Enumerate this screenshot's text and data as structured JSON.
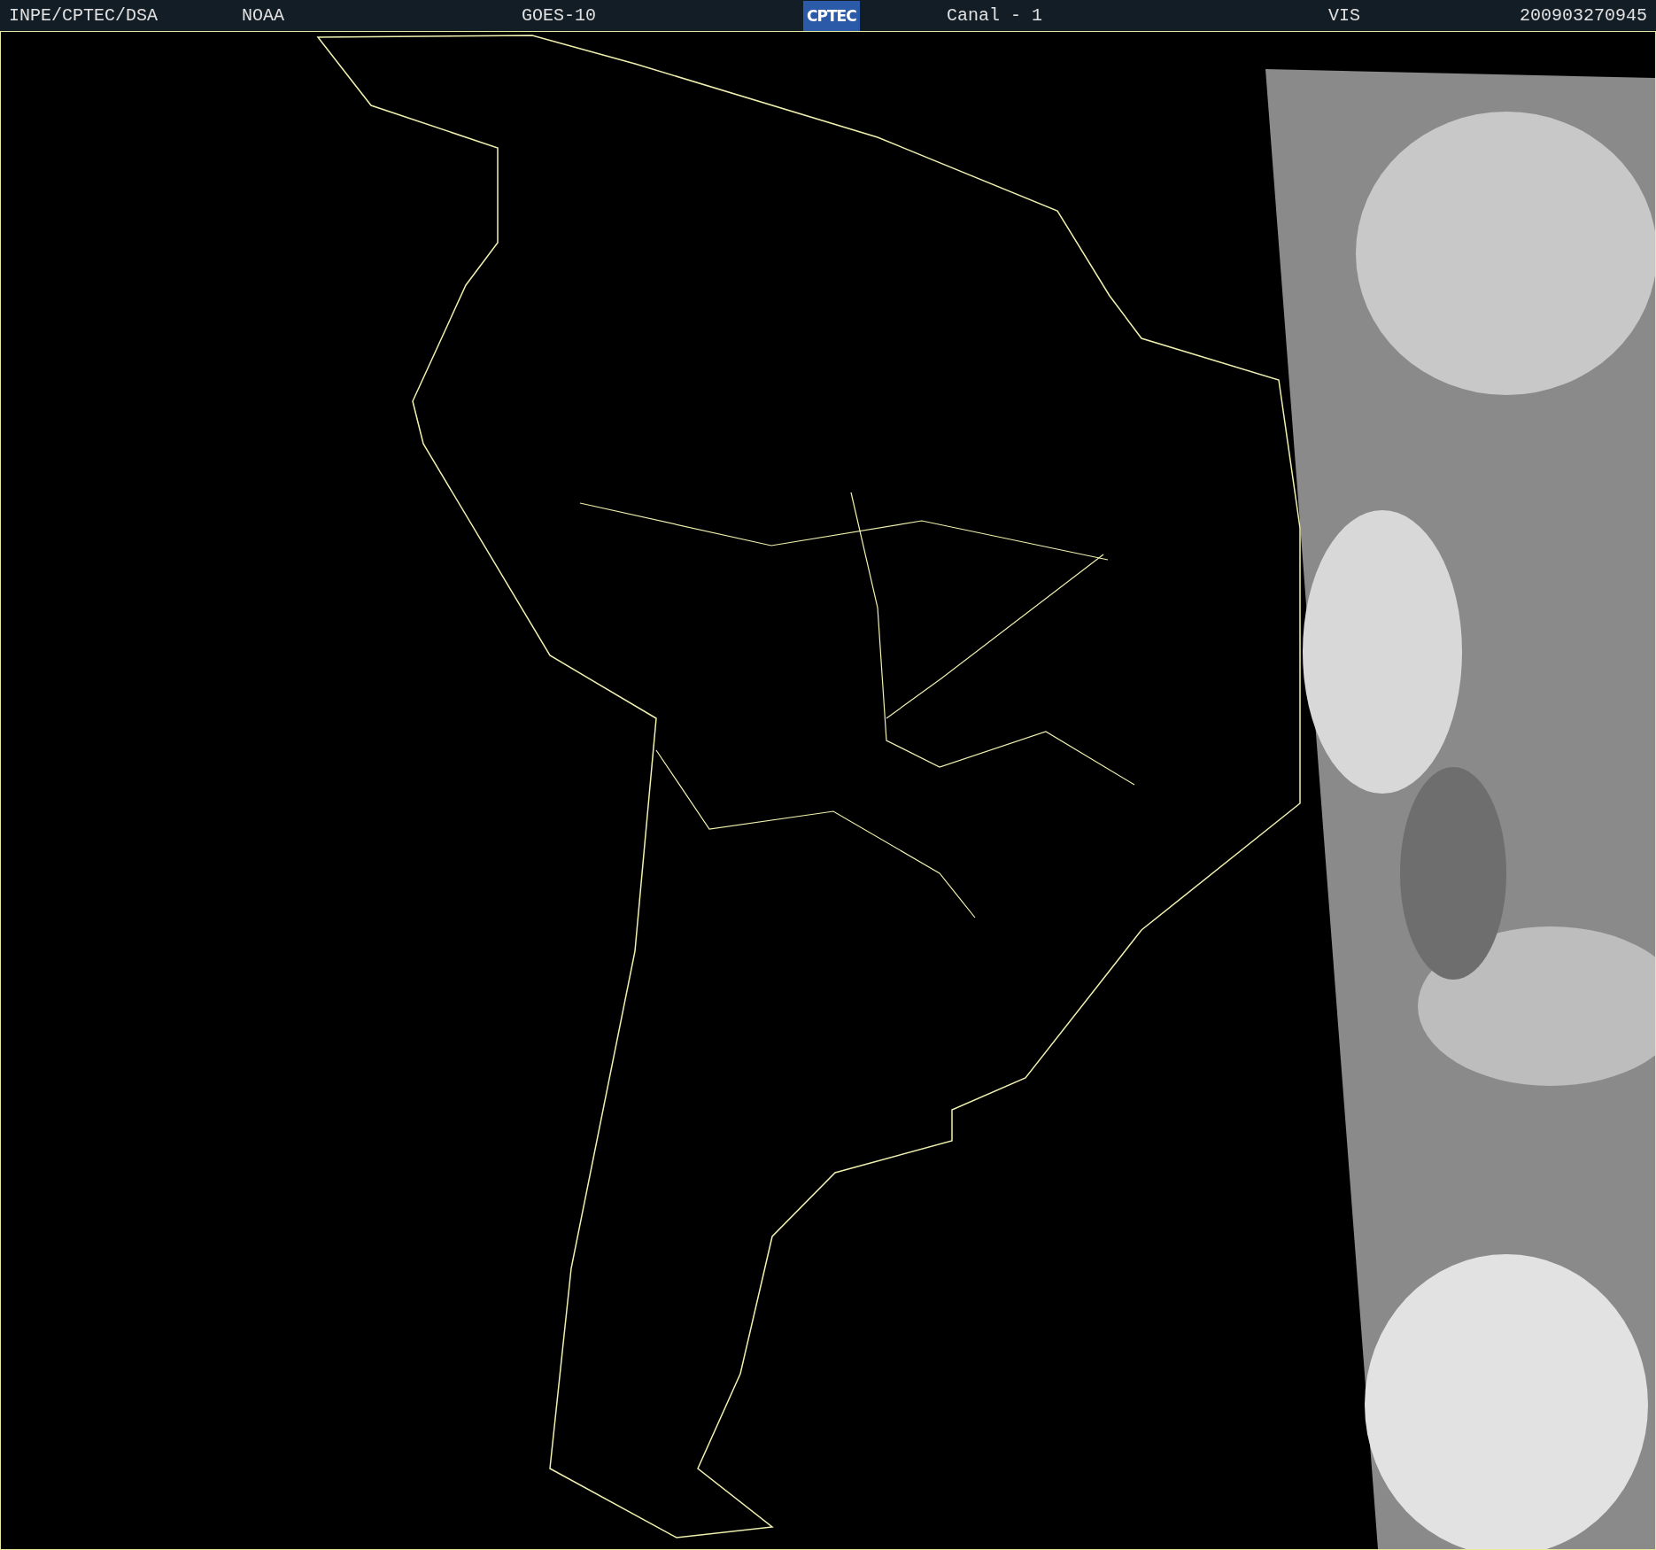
{
  "header": [
    {
      "kind": "text",
      "text": "INPE/CPTEC/DSA"
    },
    {
      "kind": "text",
      "text": "NOAA"
    },
    {
      "kind": "text",
      "text": "GOES-10"
    },
    {
      "kind": "logo",
      "text": "CPTEC"
    },
    {
      "kind": "text",
      "text": "Canal - 1"
    },
    {
      "kind": "text",
      "text": "VIS"
    },
    {
      "kind": "text",
      "text": "200903270945"
    }
  ]
}
